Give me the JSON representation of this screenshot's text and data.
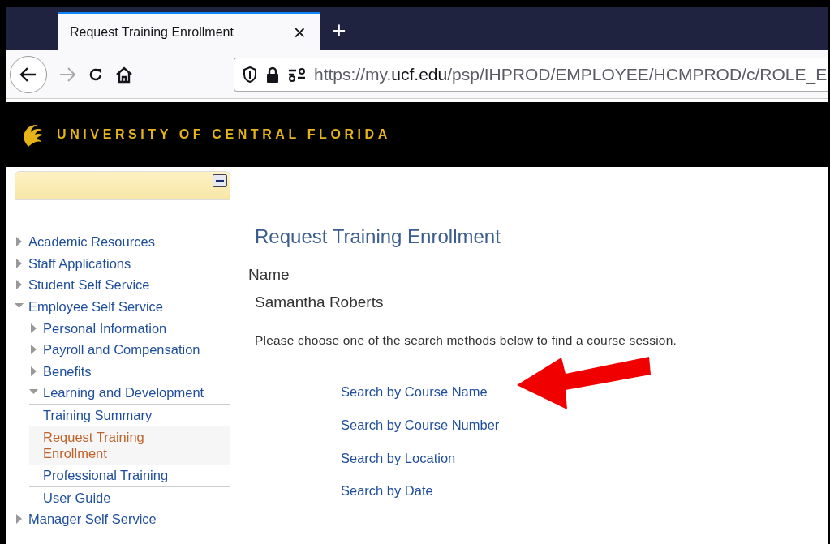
{
  "browser": {
    "tab": {
      "title": "Request Training Enrollment",
      "close": "×"
    },
    "new_tab": "+",
    "url": {
      "prefix": "https://my.",
      "domain": "ucf.edu",
      "path": "/psp/IHPROD/EMPLOYEE/HCMPROD/c/ROLE_E"
    }
  },
  "banner": {
    "title": "UNIVERSITY OF CENTRAL FLORIDA"
  },
  "sidebar": {
    "items": [
      {
        "label": "Academic Resources",
        "kind": "folder",
        "expanded": false,
        "selected": false
      },
      {
        "label": "Staff Applications",
        "kind": "folder",
        "expanded": false,
        "selected": false
      },
      {
        "label": "Student Self Service",
        "kind": "folder",
        "expanded": false,
        "selected": false
      },
      {
        "label": "Employee Self Service",
        "kind": "folder",
        "expanded": true,
        "selected": false,
        "children": [
          {
            "label": "Personal Information",
            "kind": "folder",
            "expanded": false,
            "selected": false
          },
          {
            "label": "Payroll and Compensation",
            "kind": "folder",
            "expanded": false,
            "selected": false
          },
          {
            "label": "Benefits",
            "kind": "folder",
            "expanded": false,
            "selected": false
          },
          {
            "label": "Learning and Development",
            "kind": "folder",
            "expanded": true,
            "selected": false,
            "children": [
              {
                "label": "Training Summary",
                "selected": false
              },
              {
                "label": "Request Training Enrollment",
                "selected": true
              },
              {
                "label": "Professional Training",
                "selected": false
              }
            ]
          },
          {
            "label": "User Guide",
            "selected": false
          }
        ]
      },
      {
        "label": "Manager Self Service",
        "kind": "folder",
        "expanded": false,
        "selected": false
      }
    ]
  },
  "main": {
    "title": "Request Training Enrollment",
    "name_label": "Name",
    "name_value": "Samantha Roberts",
    "instructions": "Please choose one of the search methods below to find a course session.",
    "links": [
      "Search by Course Name",
      "Search by Course Number",
      "Search by Location",
      "Search by Date"
    ]
  }
}
